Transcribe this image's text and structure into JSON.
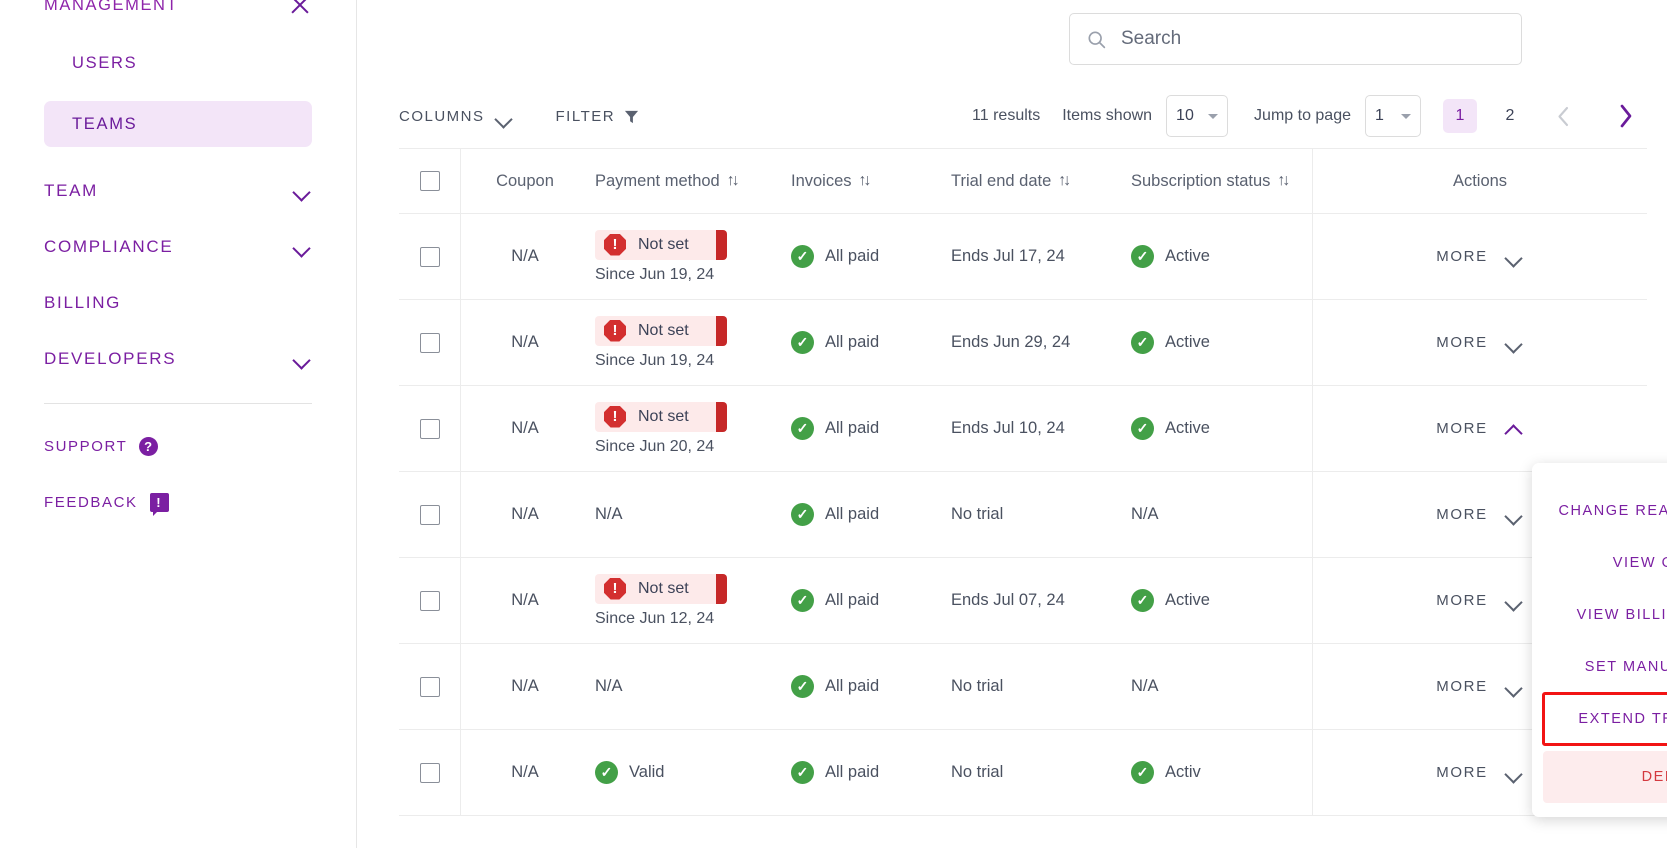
{
  "sidebar": {
    "header": {
      "label": "MANAGEMENT",
      "icon": "close-icon"
    },
    "sub_items": [
      {
        "label": "USERS",
        "active": false
      },
      {
        "label": "TEAMS",
        "active": true
      }
    ],
    "groups": [
      {
        "label": "TEAM",
        "icon": "chevron-down-icon",
        "has_chevron": true
      },
      {
        "label": "COMPLIANCE",
        "icon": "chevron-down-icon",
        "has_chevron": true
      },
      {
        "label": "BILLING",
        "icon": "",
        "has_chevron": false
      },
      {
        "label": "DEVELOPERS",
        "icon": "chevron-down-icon",
        "has_chevron": true
      }
    ],
    "footer": [
      {
        "label": "SUPPORT",
        "badge": "?",
        "badge_shape": "circle"
      },
      {
        "label": "FEEDBACK",
        "badge": "!",
        "badge_shape": "square"
      }
    ]
  },
  "search": {
    "placeholder": "Search",
    "value": "",
    "icon": "search-icon"
  },
  "toolbar": {
    "columns_label": "COLUMNS",
    "filter_label": "FILTER",
    "results_label": "11 results",
    "items_shown_label": "Items shown",
    "items_shown_value": "10",
    "jump_label": "Jump to page",
    "jump_value": "1",
    "pages": [
      "1",
      "2"
    ],
    "active_page": "1",
    "prev_icon": "chevron-left-icon",
    "next_icon": "chevron-right-icon"
  },
  "table": {
    "headers": [
      {
        "label": "",
        "sortable": false
      },
      {
        "label": "Coupon",
        "sortable": false
      },
      {
        "label": "Payment method",
        "sortable": true
      },
      {
        "label": "Invoices",
        "sortable": true
      },
      {
        "label": "Trial end date",
        "sortable": true
      },
      {
        "label": "Subscription status",
        "sortable": true
      },
      {
        "label": "Actions",
        "sortable": false
      }
    ],
    "sort_glyph": "↑↓",
    "more_label": "MORE",
    "rows": [
      {
        "coupon": "N/A",
        "payment_status": "Not set",
        "payment_since": "Since Jun 19, 24",
        "payment_type": "notset",
        "invoices": "All paid",
        "trial": "Ends Jul 17, 24",
        "subscription": "Active",
        "sub_type": "ok",
        "menu_open": false
      },
      {
        "coupon": "N/A",
        "payment_status": "Not set",
        "payment_since": "Since Jun 19, 24",
        "payment_type": "notset",
        "invoices": "All paid",
        "trial": "Ends Jun 29, 24",
        "subscription": "Active",
        "sub_type": "ok",
        "menu_open": false
      },
      {
        "coupon": "N/A",
        "payment_status": "Not set",
        "payment_since": "Since Jun 20, 24",
        "payment_type": "notset",
        "invoices": "All paid",
        "trial": "Ends Jul 10, 24",
        "subscription": "Active",
        "sub_type": "ok",
        "menu_open": true
      },
      {
        "coupon": "N/A",
        "payment_status": "N/A",
        "payment_since": "",
        "payment_type": "text",
        "invoices": "All paid",
        "trial": "No trial",
        "subscription": "N/A",
        "sub_type": "text",
        "menu_open": false
      },
      {
        "coupon": "N/A",
        "payment_status": "Not set",
        "payment_since": "Since Jun 12, 24",
        "payment_type": "notset",
        "invoices": "All paid",
        "trial": "Ends Jul 07, 24",
        "subscription": "Active",
        "sub_type": "ok",
        "menu_open": false
      },
      {
        "coupon": "N/A",
        "payment_status": "N/A",
        "payment_since": "",
        "payment_type": "text",
        "invoices": "All paid",
        "trial": "No trial",
        "subscription": "N/A",
        "sub_type": "text",
        "menu_open": false
      },
      {
        "coupon": "N/A",
        "payment_status": "Valid",
        "payment_since": "",
        "payment_type": "ok",
        "invoices": "All paid",
        "trial": "No trial",
        "subscription": "Activ",
        "sub_type": "ok",
        "menu_open": false
      }
    ]
  },
  "dropdown": {
    "items": [
      {
        "label": "CHANGE READ-ONLY STATE",
        "style": "normal"
      },
      {
        "label": "VIEW OWNERS",
        "style": "normal"
      },
      {
        "label": "VIEW BILLING HISTORY",
        "style": "normal"
      },
      {
        "label": "SET MANUAL BILLING",
        "style": "normal"
      },
      {
        "label": "EXTEND TRAIL PERIOD",
        "style": "highlighted"
      },
      {
        "label": "DELETE",
        "style": "danger"
      }
    ]
  },
  "colors": {
    "brand_purple": "#7b1fa2",
    "active_bg": "#f3e5f8",
    "danger_red": "#d32f2f",
    "success_green": "#43a047",
    "highlight_outline": "#f21414"
  }
}
